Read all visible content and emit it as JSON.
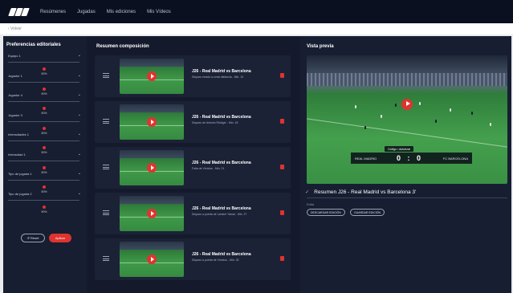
{
  "nav": {
    "items": [
      "Resúmenes",
      "Jugadas",
      "Mis ediciones",
      "Mis Vídeos"
    ]
  },
  "breadcrumb": "‹ Volver",
  "preferences": {
    "title": "Preferencias editoriales",
    "items": [
      {
        "label": "Equipo 1",
        "value": "50%"
      },
      {
        "label": "Jugador 1",
        "value": "50%"
      },
      {
        "label": "Jugador 4",
        "value": "50%"
      },
      {
        "label": "Jugador 3",
        "value": "50%"
      },
      {
        "label": "Intensidades 1",
        "value": "50%"
      },
      {
        "label": "Intensidad 1",
        "value": "50%"
      },
      {
        "label": "Tipo de jugada 1",
        "value": "50%"
      },
      {
        "label": "Tipo de jugada 2",
        "value": "50%"
      }
    ],
    "reset_label": "↺ Reset",
    "apply_label": "Aplicar"
  },
  "composition": {
    "title": "Resumen composición",
    "items": [
      {
        "title": "J26 - Real Madrid vs Barcelona",
        "subtitle": "Disparo errado a corta distancia - Min. 10"
      },
      {
        "title": "J26 - Real Madrid vs Barcelona",
        "subtitle": "Disparo de Antonio Rüdiger - Min. 18"
      },
      {
        "title": "J26 - Real Madrid vs Barcelona",
        "subtitle": "Falta de Vinícius - Min. 21"
      },
      {
        "title": "J26 - Real Madrid vs Barcelona",
        "subtitle": "Disparo a puerta de Lamine Yamal - Min. 27"
      },
      {
        "title": "J26 - Real Madrid vs Barcelona",
        "subtitle": "Disparo a puerta de Vinícius - Min. 33"
      }
    ]
  },
  "preview": {
    "title": "Vista previa",
    "tag": "Código • Autorizar",
    "home": "REAL MADRID",
    "away": "FC BARCELONA",
    "score": "0 : 0",
    "video_title": "Resumen J26 - Real Madrid vs Barcelona 3'",
    "subline": "Edita",
    "btn_download": "DESCARGAR EDICIÓN",
    "btn_save": "GUARDAR EDICIÓN"
  },
  "colors": {
    "accent": "#e0332f",
    "bg": "#141a2b",
    "panel": "#171e31"
  }
}
